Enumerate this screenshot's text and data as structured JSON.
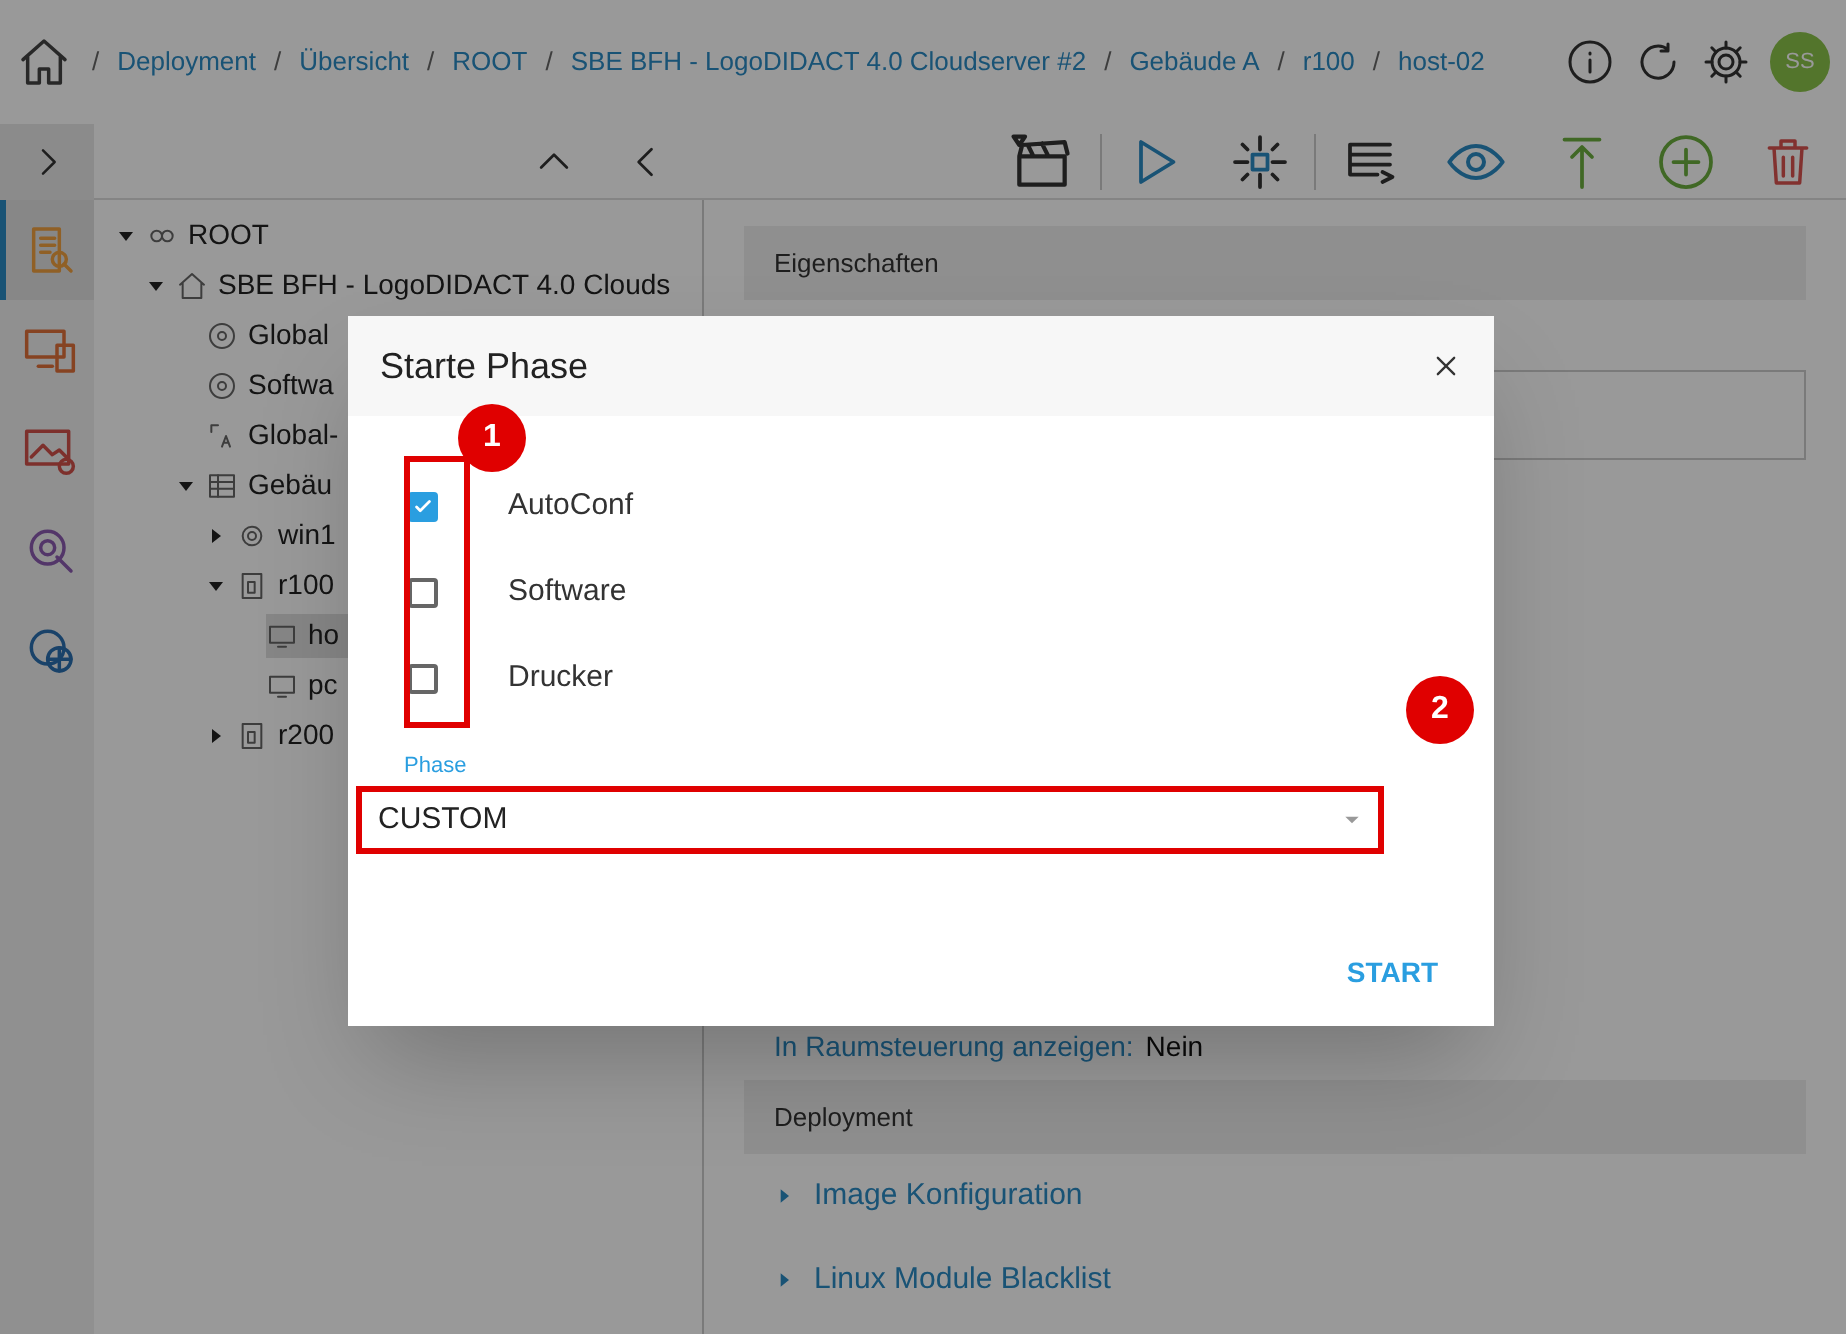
{
  "breadcrumbs": [
    "Deployment",
    "Übersicht",
    "ROOT",
    "SBE BFH - LogoDIDACT 4.0 Cloudserver #2",
    "Gebäude A",
    "r100",
    "host-02"
  ],
  "breadcrumb_separator": "/",
  "avatar": {
    "initials": "SS"
  },
  "rail": [
    {
      "kind": "docs",
      "selected": true
    },
    {
      "kind": "devices",
      "selected": false
    },
    {
      "kind": "images",
      "selected": false
    },
    {
      "kind": "tools",
      "selected": false
    },
    {
      "kind": "network",
      "selected": false
    }
  ],
  "tree": [
    {
      "label": "ROOT",
      "kind": "root",
      "expanded": true,
      "selected": false,
      "children": [
        {
          "label": "SBE BFH - LogoDIDACT 4.0 Clouds",
          "kind": "site",
          "expanded": true,
          "selected": false,
          "children": [
            {
              "label": "Global",
              "kind": "disk",
              "selected": false
            },
            {
              "label": "Softwa",
              "kind": "disk",
              "selected": false
            },
            {
              "label": "Global-",
              "kind": "config",
              "selected": false
            },
            {
              "label": "Gebäu",
              "kind": "building",
              "expanded": true,
              "selected": false,
              "children": [
                {
                  "label": "win1",
                  "kind": "group",
                  "expanded": false,
                  "selected": false
                },
                {
                  "label": "r100",
                  "kind": "room",
                  "expanded": true,
                  "selected": false,
                  "children": [
                    {
                      "label": "ho",
                      "kind": "host",
                      "selected": true
                    },
                    {
                      "label": "pc",
                      "kind": "host",
                      "selected": false
                    }
                  ]
                },
                {
                  "label": "r200",
                  "kind": "room",
                  "expanded": false,
                  "selected": false
                }
              ]
            }
          ]
        }
      ]
    }
  ],
  "properties": {
    "header": "Eigenschaften",
    "fields": [
      {
        "label": "In Raumsteuerung anzeigen:",
        "value": "Nein"
      }
    ]
  },
  "deployment": {
    "header": "Deployment",
    "items": [
      "Image Konfiguration",
      "Linux Module Blacklist"
    ]
  },
  "dialog": {
    "title": "Starte Phase",
    "options": [
      {
        "label": "AutoConf",
        "checked": true
      },
      {
        "label": "Software",
        "checked": false
      },
      {
        "label": "Drucker",
        "checked": false
      }
    ],
    "phase": {
      "label": "Phase",
      "value": "CUSTOM"
    },
    "button": "START"
  },
  "annotations": [
    "1",
    "2"
  ]
}
